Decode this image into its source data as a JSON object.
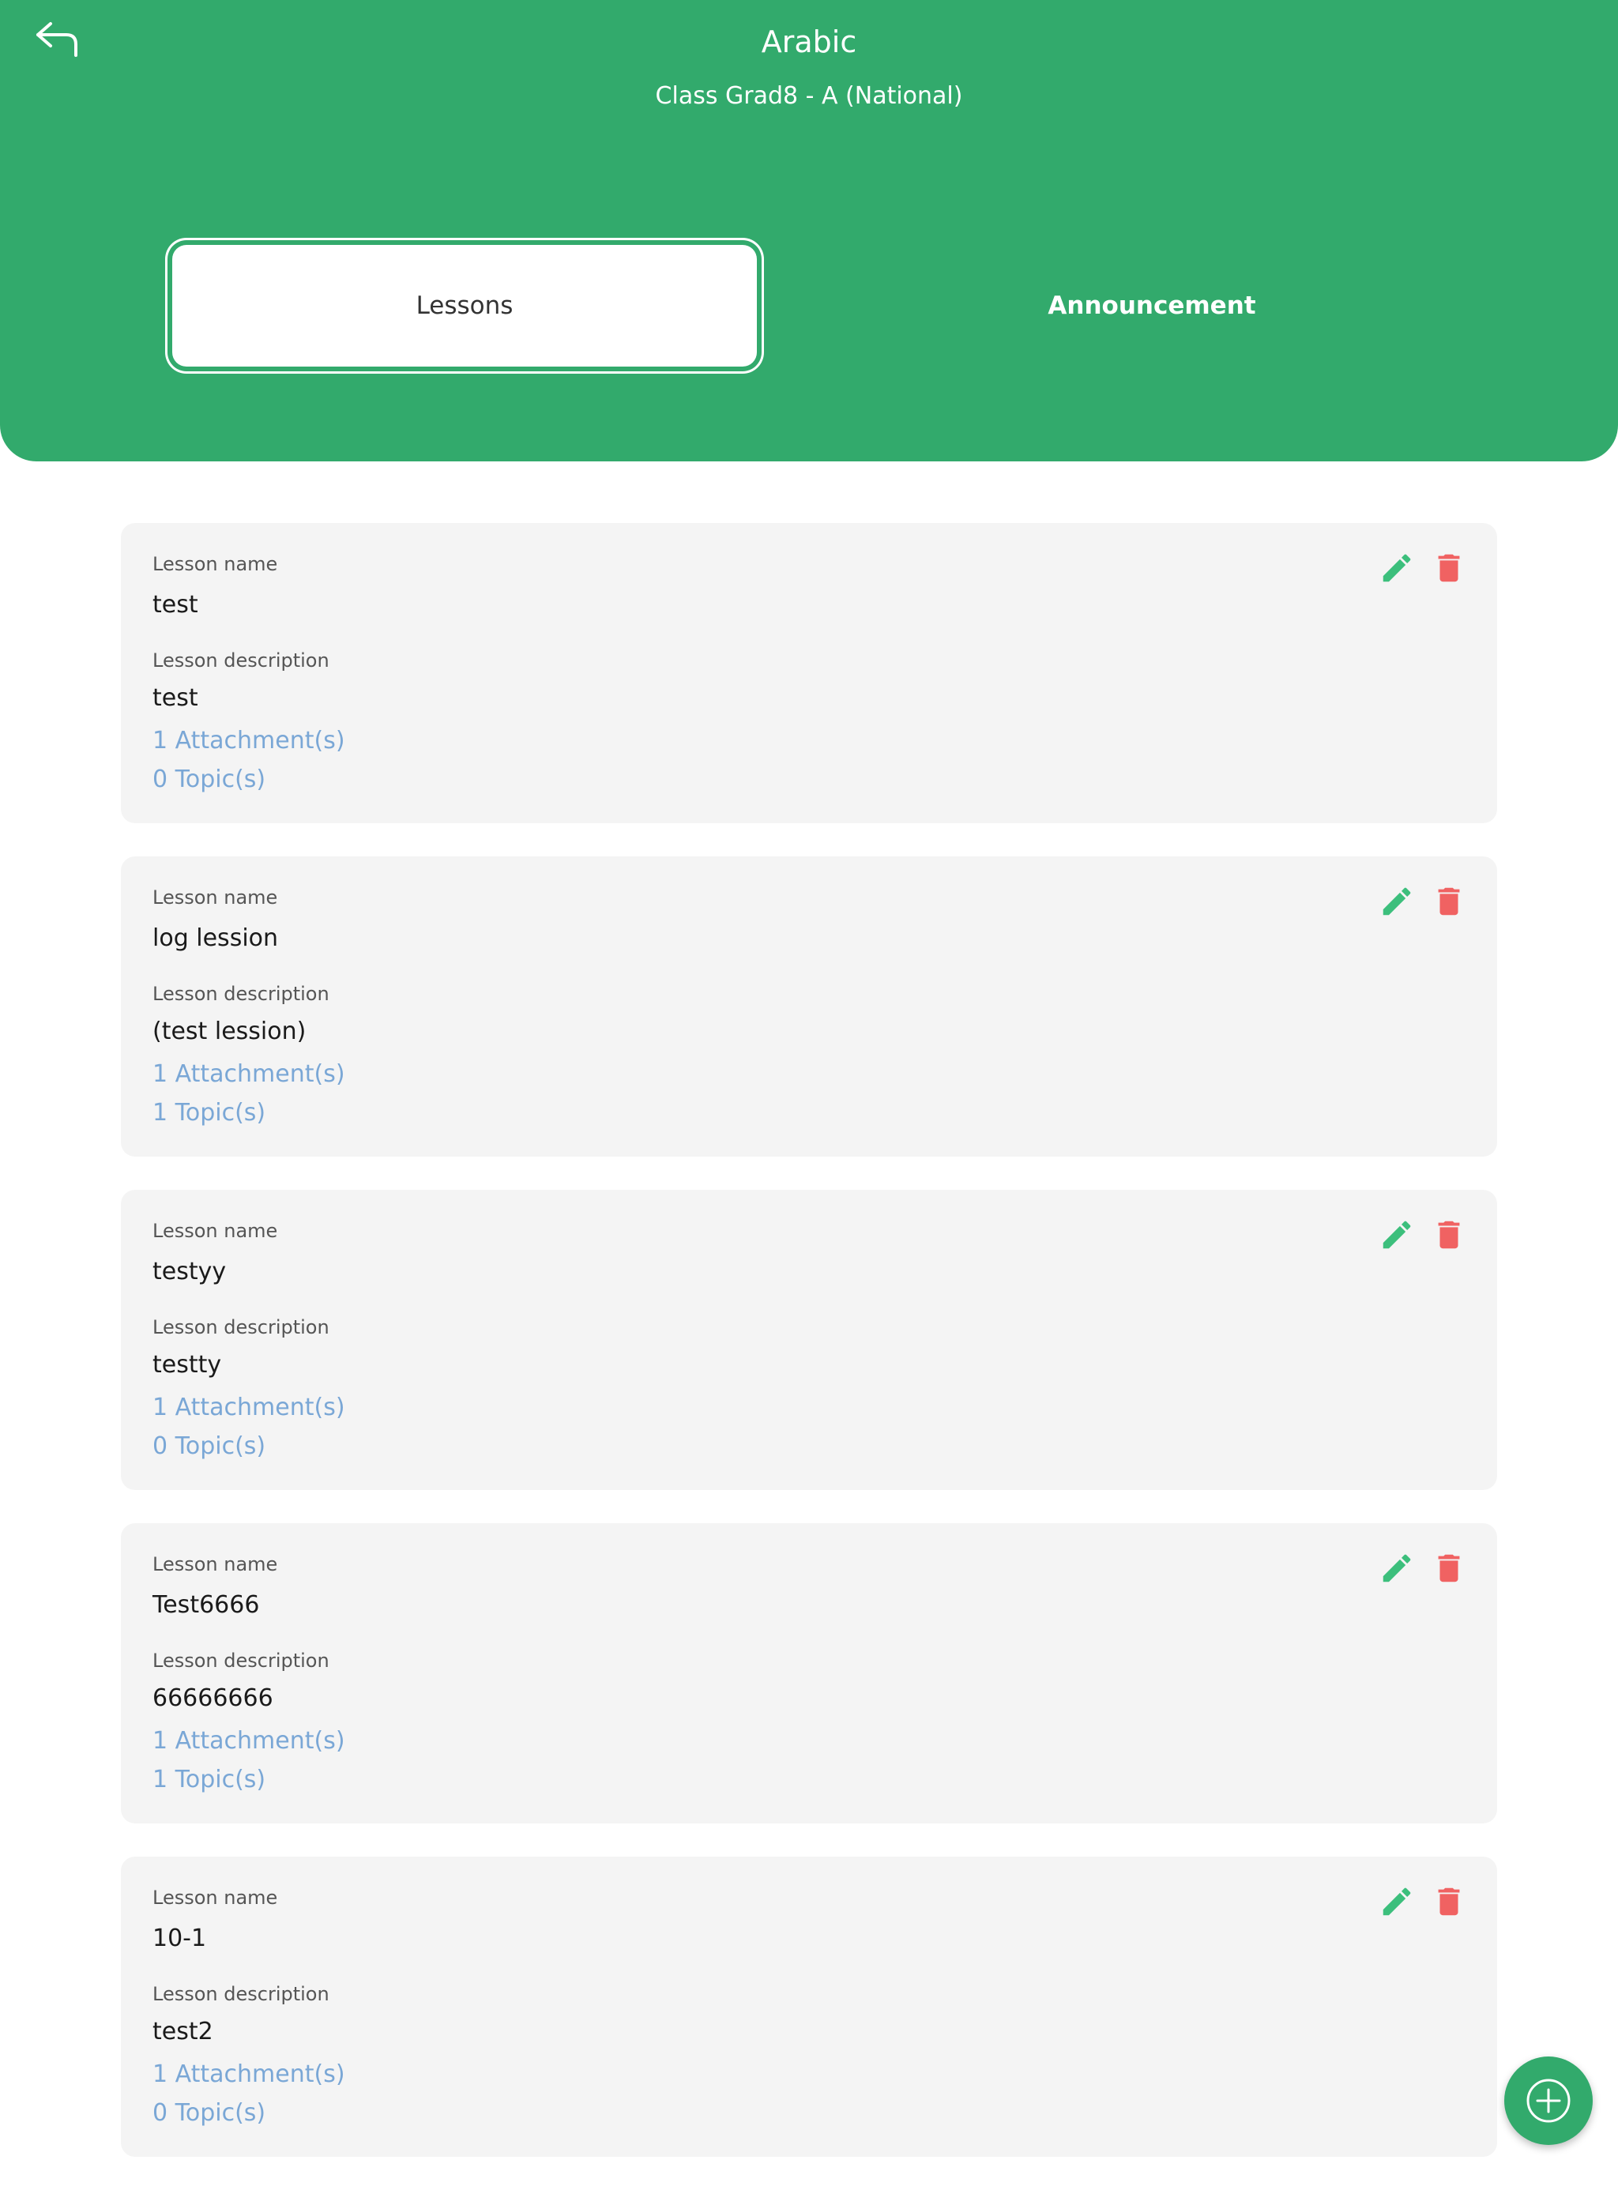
{
  "header": {
    "title": "Arabic",
    "subtitle": "Class Grad8 - A (National)",
    "back_icon": "back-arrow-icon"
  },
  "tabs": [
    {
      "label": "Lessons",
      "active": true
    },
    {
      "label": "Announcement",
      "active": false
    }
  ],
  "labels": {
    "lesson_name": "Lesson name",
    "lesson_description": "Lesson description"
  },
  "lessons": [
    {
      "name": "test",
      "description": "test",
      "attachments": "1 Attachment(s)",
      "topics": "0 Topic(s)"
    },
    {
      "name": "log lession",
      "description": "(test lession)",
      "attachments": "1 Attachment(s)",
      "topics": "1 Topic(s)"
    },
    {
      "name": "testyy",
      "description": "testty",
      "attachments": "1 Attachment(s)",
      "topics": "0 Topic(s)"
    },
    {
      "name": "Test6666",
      "description": "66666666",
      "attachments": "1 Attachment(s)",
      "topics": "1 Topic(s)"
    },
    {
      "name": "10-1",
      "description": "test2",
      "attachments": "1 Attachment(s)",
      "topics": "0 Topic(s)"
    }
  ],
  "icons": {
    "edit": "pencil-icon",
    "delete": "trash-icon",
    "add": "plus-circle-icon"
  },
  "colors": {
    "primary": "#32aa6c",
    "edit_icon": "#3cbf7c",
    "delete_icon": "#f06262",
    "link": "#7aa7d6",
    "card_bg": "#f4f4f4"
  }
}
